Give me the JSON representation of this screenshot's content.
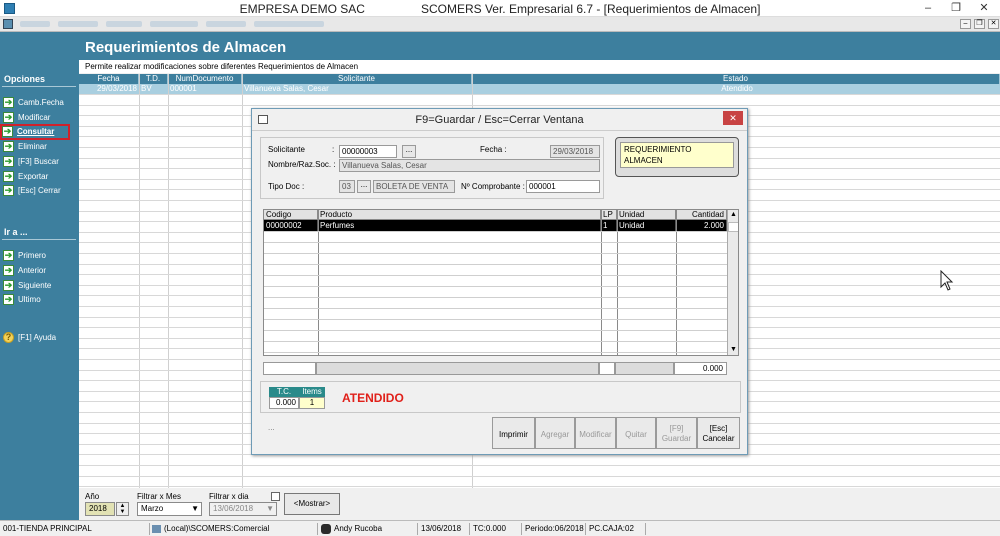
{
  "window": {
    "company": "EMPRESA DEMO SAC",
    "title": "SCOMERS Ver. Empresarial  6.7 - [Requerimientos de Almacen]",
    "min": "–",
    "restore": "❐",
    "close": "✕"
  },
  "page": {
    "title": "Requerimientos de Almacen",
    "subtitle": "Permite realizar modificaciones sobre diferentes Requerimientos de Almacen"
  },
  "sidebar": {
    "options_header": "Opciones",
    "goto_header": "Ir a ...",
    "options": [
      {
        "label": "Camb.Fecha",
        "icon": "arrow-right-icon"
      },
      {
        "label": "Modificar",
        "icon": "arrow-right-icon"
      },
      {
        "label": "Consultar",
        "icon": "arrow-right-icon"
      },
      {
        "label": "Eliminar",
        "icon": "arrow-right-icon"
      },
      {
        "label": "[F3] Buscar",
        "icon": "arrow-right-icon"
      },
      {
        "label": "Exportar",
        "icon": "arrow-right-icon"
      },
      {
        "label": "[Esc] Cerrar",
        "icon": "arrow-right-icon"
      }
    ],
    "goto": [
      {
        "label": "Primero",
        "icon": "arrow-right-icon"
      },
      {
        "label": "Anterior",
        "icon": "arrow-right-icon"
      },
      {
        "label": "Siguiente",
        "icon": "arrow-right-icon"
      },
      {
        "label": "Ultimo",
        "icon": "arrow-right-icon"
      }
    ],
    "help": {
      "label": "[F1] Ayuda",
      "icon": "help-icon"
    }
  },
  "grid": {
    "columns": [
      "Fecha",
      "T.D.",
      "NumDocumento",
      "Solicitante",
      "Estado"
    ],
    "rows": [
      [
        "29/03/2018",
        "BV",
        "000001",
        "Villanueva  Salas, Cesar",
        "Atendido"
      ]
    ]
  },
  "filter": {
    "year_label": "Año",
    "year_value": "2018",
    "month_label": "Filtrar x Mes",
    "month_value": "Marzo",
    "day_label": "Filtrar x dia",
    "day_value": "13/06/2018",
    "show_button": "<Mostrar>"
  },
  "status": {
    "store": "001-TIENDA PRINCIPAL",
    "db": "(Local)\\SCOMERS:Comercial",
    "user": "Andy Rucoba",
    "date": "13/06/2018",
    "tc": "TC:0.000",
    "period": "Periodo:06/2018",
    "cash": "PC.CAJA:02"
  },
  "dialog": {
    "title": "F9=Guardar / Esc=Cerrar Ventana",
    "close": "✕",
    "solicitante_label": "Solicitante",
    "colon": ":",
    "solicitante_value": "00000003",
    "fecha_label": "Fecha :",
    "fecha_value": "29/03/2018",
    "nombre_label": "Nombre/Raz.Soc. :",
    "nombre_value": "Villanueva  Salas, Cesar",
    "tipo_label": "Tipo Doc :",
    "tipo_code": "03",
    "tipo_desc": "BOLETA DE VENTA",
    "comprobante_label": "Nº Comprobante :",
    "comprobante_value": "000001",
    "badge": "REQUERIMIENTO ALMACEN",
    "dots": "...",
    "items_columns": [
      "Codigo",
      "Producto",
      "LP",
      "Unidad",
      "Cantidad"
    ],
    "items": [
      [
        "00000002",
        "Perfumes",
        "1",
        "Unidad",
        "2.000"
      ]
    ],
    "total": "0.000",
    "tc_label": "T.C.",
    "tc_value": "0.000",
    "items_label": "Items",
    "items_count": "1",
    "state": "ATENDIDO",
    "ellipsis": "...",
    "buttons": {
      "print": "Imprimir",
      "add": "Agregar",
      "modify": "Modificar",
      "remove": "Quitar",
      "save_key": "[F9]",
      "save": "Guardar",
      "cancel_key": "[Esc]",
      "cancel": "Cancelar"
    }
  }
}
